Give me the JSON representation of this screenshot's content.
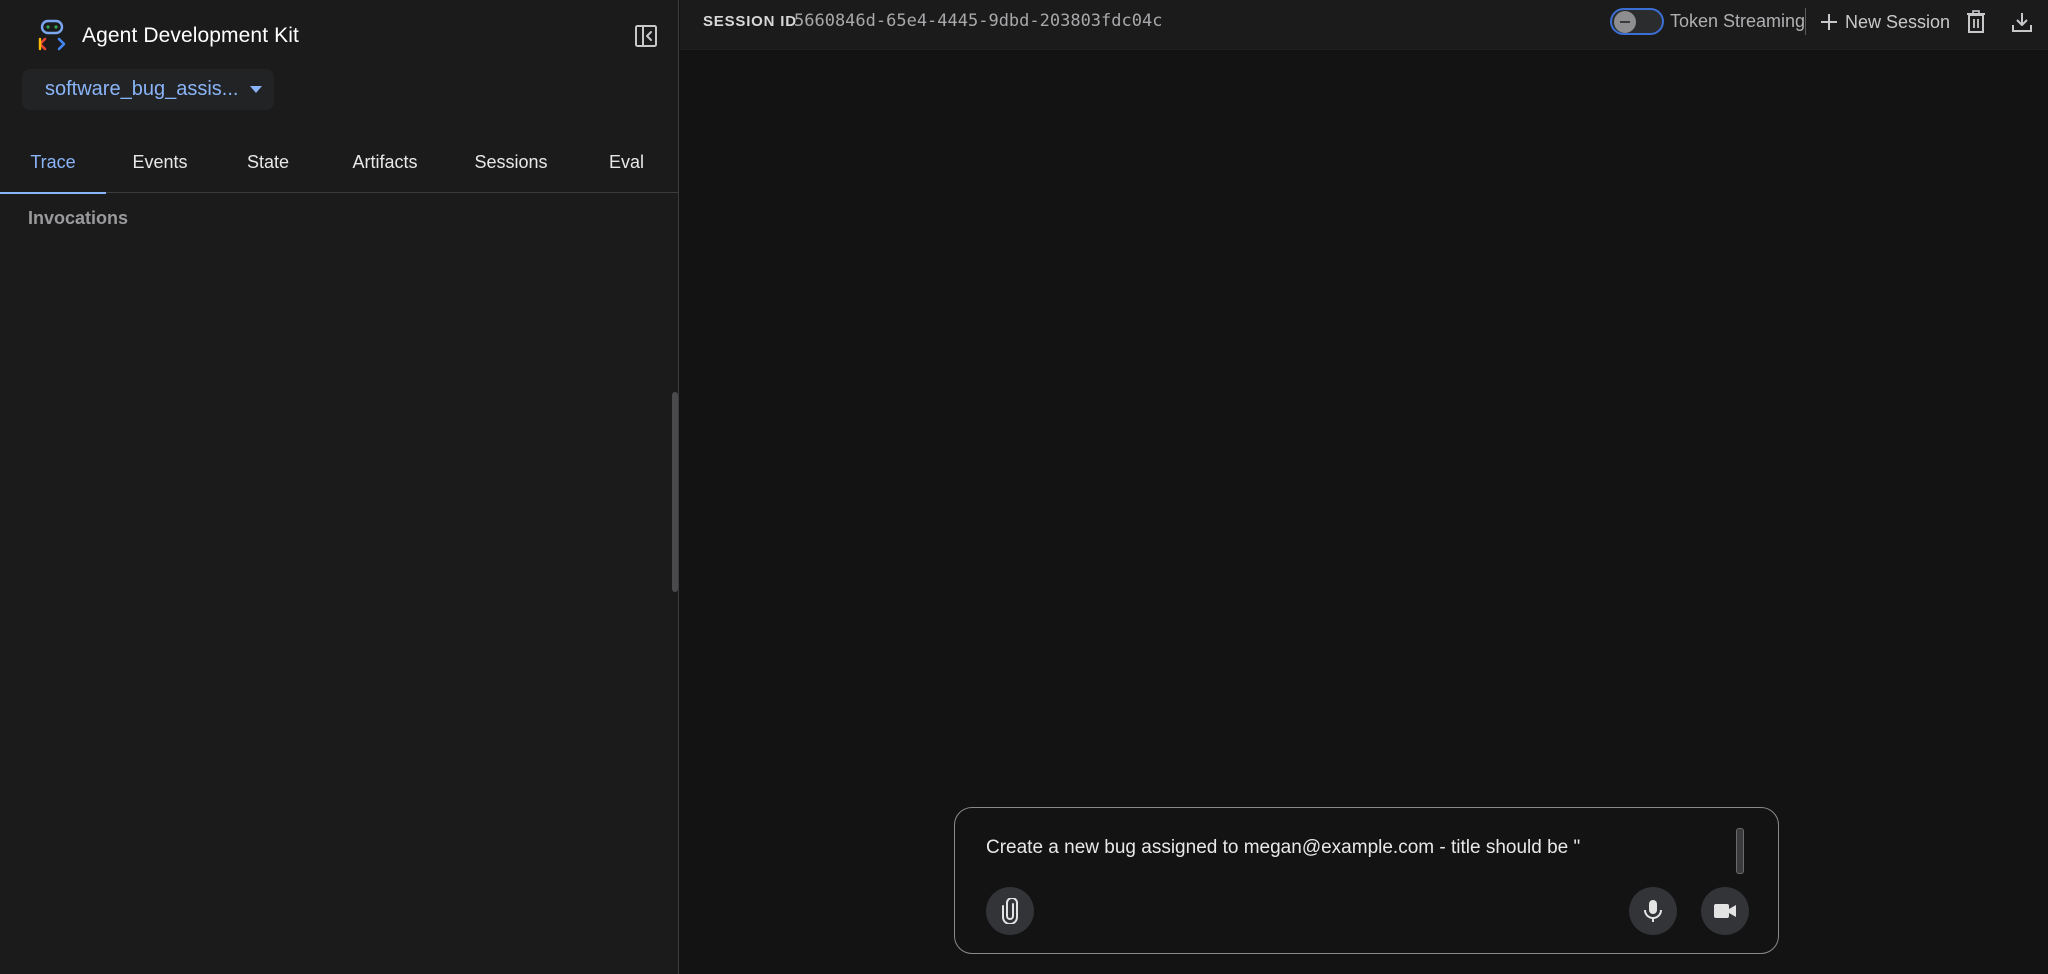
{
  "app": {
    "title": "Agent Development Kit",
    "selected_app": "software_bug_assis..."
  },
  "sidebar": {
    "tabs": [
      {
        "label": "Trace",
        "active": true
      },
      {
        "label": "Events",
        "active": false
      },
      {
        "label": "State",
        "active": false
      },
      {
        "label": "Artifacts",
        "active": false
      },
      {
        "label": "Sessions",
        "active": false
      },
      {
        "label": "Eval",
        "active": false
      }
    ],
    "section_title": "Invocations"
  },
  "topbar": {
    "session_label": "SESSION ID",
    "session_id": "5660846d-65e4-4445-9dbd-203803fdc04c",
    "token_streaming_label": "Token Streaming",
    "token_streaming_enabled": false,
    "new_session_label": "New Session"
  },
  "composer": {
    "value": "Create a new bug assigned to megan@example.com - title should be \""
  },
  "icons": {
    "logo": "adk-logo-icon",
    "collapse": "sidebar-collapse-icon",
    "dropdown": "caret-down-icon",
    "add": "plus-icon",
    "delete": "trash-icon",
    "download": "download-icon",
    "attach": "paperclip-icon",
    "mic": "microphone-icon",
    "video": "video-camera-icon"
  },
  "colors": {
    "accent": "#8ab4f8",
    "sidebar_bg": "#1b1b1c",
    "main_bg": "#131314",
    "toggle_border": "#3b6fd4"
  }
}
